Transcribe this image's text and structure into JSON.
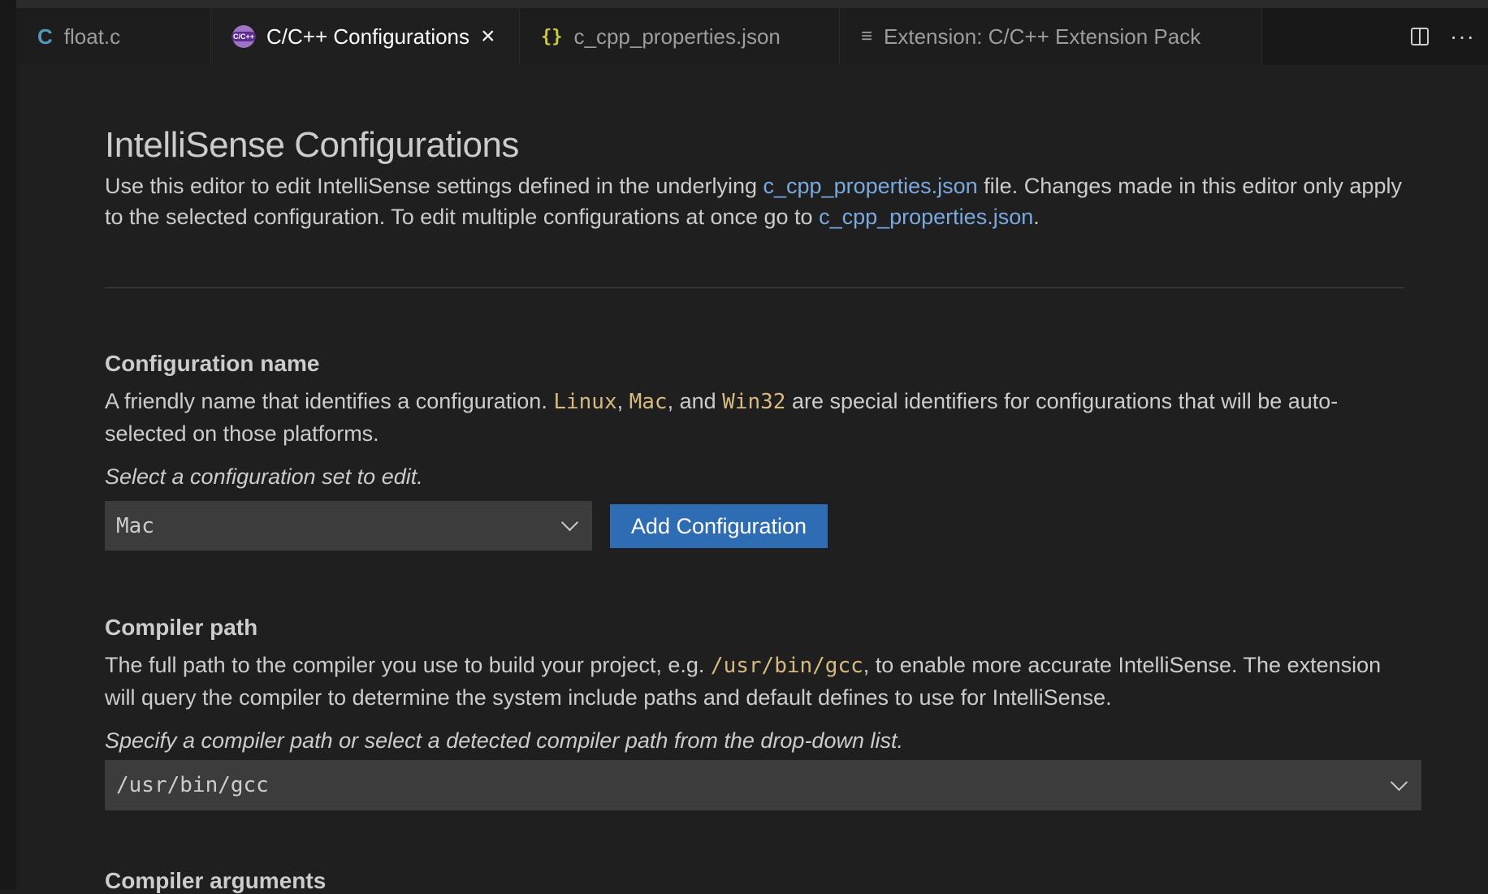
{
  "tabs": [
    {
      "label": "float.c",
      "icon": "c-file-icon",
      "active": false
    },
    {
      "label": "C/C++ Configurations",
      "icon": "cpp-extension-icon",
      "active": true
    },
    {
      "label": "c_cpp_properties.json",
      "icon": "json-braces-icon",
      "active": false
    },
    {
      "label": "Extension: C/C++ Extension Pack",
      "icon": "extension-preview-icon",
      "active": false
    }
  ],
  "tab_icons": {
    "c": "C",
    "json": "{}",
    "ext": "≡",
    "close": "×",
    "more": "···"
  },
  "page": {
    "title": "IntelliSense Configurations",
    "intro_part1": "Use this editor to edit IntelliSense settings defined in the underlying ",
    "intro_link1": "c_cpp_properties.json",
    "intro_part2": " file. Changes made in this editor only apply to the selected configuration. To edit multiple configurations at once go to ",
    "intro_link2": "c_cpp_properties.json",
    "intro_part3": "."
  },
  "config_name": {
    "title": "Configuration name",
    "desc_part1": "A friendly name that identifies a configuration. ",
    "kw1": "Linux",
    "sep1": ", ",
    "kw2": "Mac",
    "sep2": ", and ",
    "kw3": "Win32",
    "desc_part2": " are special identifiers for configurations that will be auto-selected on those platforms.",
    "hint": "Select a configuration set to edit.",
    "selected": "Mac",
    "add_button": "Add Configuration"
  },
  "compiler_path": {
    "title": "Compiler path",
    "desc_part1": "The full path to the compiler you use to build your project, e.g. ",
    "example": "/usr/bin/gcc",
    "desc_part2": ", to enable more accurate IntelliSense. The extension will query the compiler to determine the system include paths and default defines to use for IntelliSense.",
    "hint": "Specify a compiler path or select a detected compiler path from the drop-down list.",
    "value": "/usr/bin/gcc"
  },
  "compiler_args": {
    "title": "Compiler arguments"
  },
  "colors": {
    "background": "#1f1f1f",
    "link": "#7aa9e0",
    "keyword": "#d7ba7d",
    "button": "#2e6db4",
    "input_bg": "#3c3c3c"
  }
}
